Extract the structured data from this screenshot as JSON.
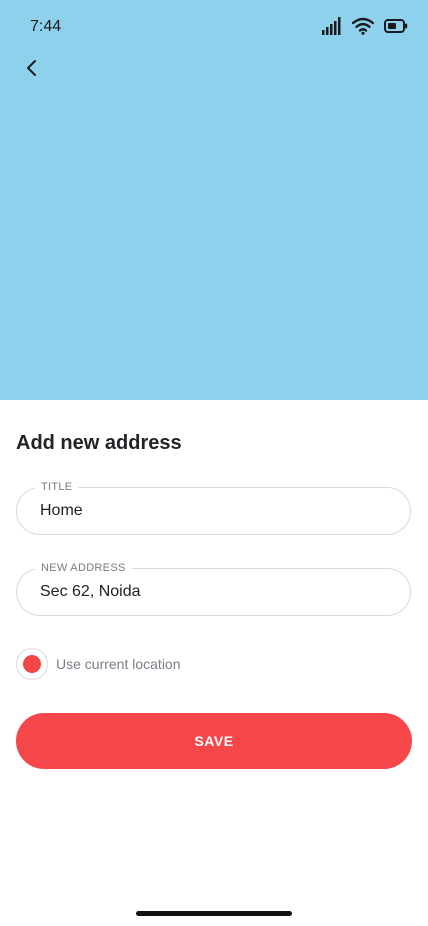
{
  "status_bar": {
    "time": "7:44",
    "icons": [
      "signal-icon",
      "wifi-icon",
      "battery-icon"
    ]
  },
  "map": {
    "background_color": "#8dd1ec"
  },
  "nav": {
    "back_icon": "chevron-left-icon"
  },
  "form": {
    "title": "Add new address",
    "fields": [
      {
        "label": "TITLE",
        "value": "Home"
      },
      {
        "label": "NEW ADDRESS",
        "value": "Sec 62, Noida"
      }
    ],
    "use_current_location": {
      "label": "Use current location",
      "checked": true
    },
    "save_label": "SAVE"
  },
  "colors": {
    "accent": "#f5474a",
    "map": "#8dd1ec",
    "text": "#232328",
    "muted": "#7c7c88"
  }
}
